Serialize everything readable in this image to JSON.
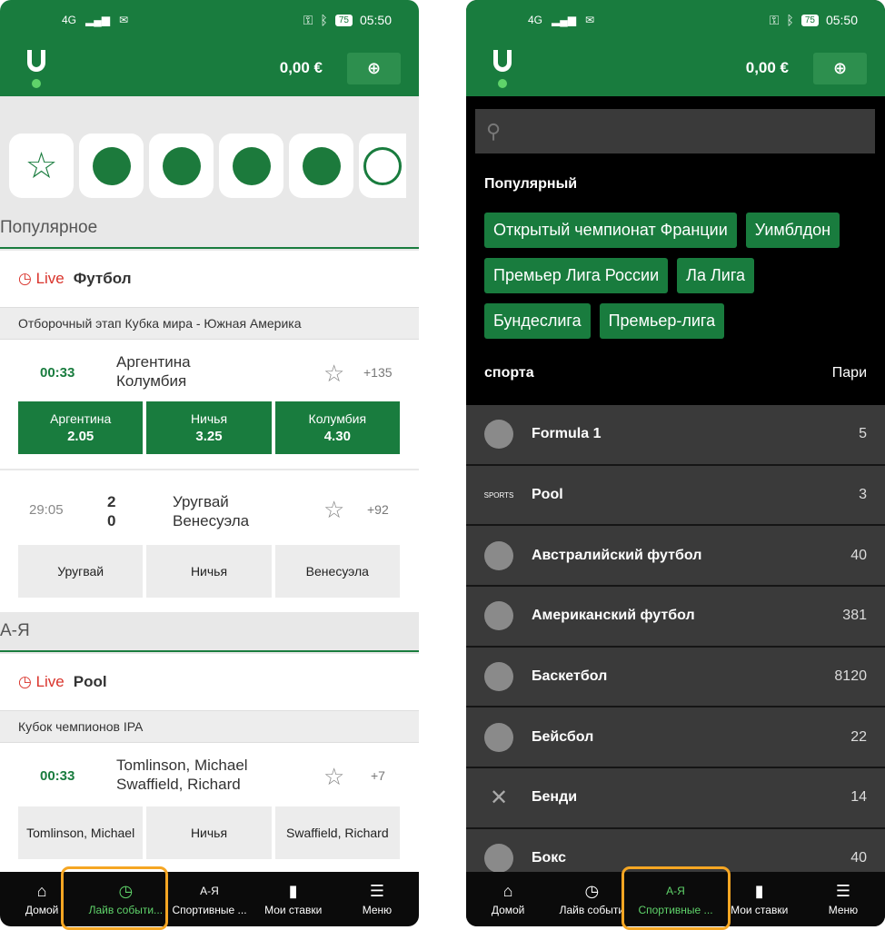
{
  "status": {
    "network": "4G",
    "time": "05:50",
    "battery": "75"
  },
  "header": {
    "balance": "0,00 €",
    "deposit_icon": "wallet-plus-icon"
  },
  "sports_icons": [
    "star-icon",
    "soccer-ball-icon",
    "tennis-ball-icon",
    "basketball-icon",
    "volleyball-icon",
    "billiard-ball-icon"
  ],
  "screen1": {
    "popular_title": "Популярное",
    "football": {
      "live": "Live",
      "sport": "Футбол",
      "competition": "Отборочный этап Кубка мира - Южная Америка"
    },
    "match1": {
      "time": "00:33",
      "team1": "Аргентина",
      "team2": "Колумбия",
      "more": "+135",
      "odds": [
        {
          "label": "Аргентина",
          "value": "2.05"
        },
        {
          "label": "Ничья",
          "value": "3.25"
        },
        {
          "label": "Колумбия",
          "value": "4.30"
        }
      ]
    },
    "match2": {
      "time": "29:05",
      "score1": "2",
      "score2": "0",
      "team1": "Уругвай",
      "team2": "Венесуэла",
      "more": "+92",
      "odds": [
        "Уругвай",
        "Ничья",
        "Венесуэла"
      ]
    },
    "az_title": "А-Я",
    "pool": {
      "live": "Live",
      "sport": "Pool",
      "competition": "Кубок чемпионов IPA"
    },
    "match3": {
      "time": "00:33",
      "team1": "Tomlinson, Michael",
      "team2": "Swaffield, Richard",
      "more": "+7",
      "odds": [
        "Tomlinson, Michael",
        "Ничья",
        "Swaffield, Richard"
      ]
    }
  },
  "screen2": {
    "popular_title": "Популярный",
    "tags": [
      "Открытый чемпионат Франции",
      "Уимблдон",
      "Премьер Лига России",
      "Ла Лига",
      "Бундеслига",
      "Премьер-лига"
    ],
    "list_head_left": "спорта",
    "list_head_right": "Пари",
    "sports": [
      {
        "name": "Formula 1",
        "count": "5",
        "icon": "helmet-icon"
      },
      {
        "name": "Pool",
        "count": "3",
        "icon": "sports-icon",
        "icon_text": "SPORTS"
      },
      {
        "name": "Австралийский футбол",
        "count": "40",
        "icon": "rugby-ball-icon"
      },
      {
        "name": "Американский футбол",
        "count": "381",
        "icon": "american-football-icon"
      },
      {
        "name": "Баскетбол",
        "count": "8120",
        "icon": "basketball-icon"
      },
      {
        "name": "Бейсбол",
        "count": "22",
        "icon": "baseball-icon"
      },
      {
        "name": "Бенди",
        "count": "14",
        "icon": "hockey-sticks-icon"
      },
      {
        "name": "Бокс",
        "count": "40",
        "icon": "boxing-glove-icon"
      }
    ]
  },
  "nav": {
    "items": [
      "Домой",
      "Лайв события",
      "Спортивные ...",
      "Мои ставки",
      "Меню"
    ],
    "items_s1": [
      "Домой",
      "Лайв событи...",
      "Спортивные ...",
      "Мои ставки",
      "Меню"
    ],
    "items_s2": [
      "Домой",
      "Лайв событи",
      "Спортивные ...",
      "Мои ставки",
      "Меню"
    ],
    "az_glyph": "А-Я"
  }
}
